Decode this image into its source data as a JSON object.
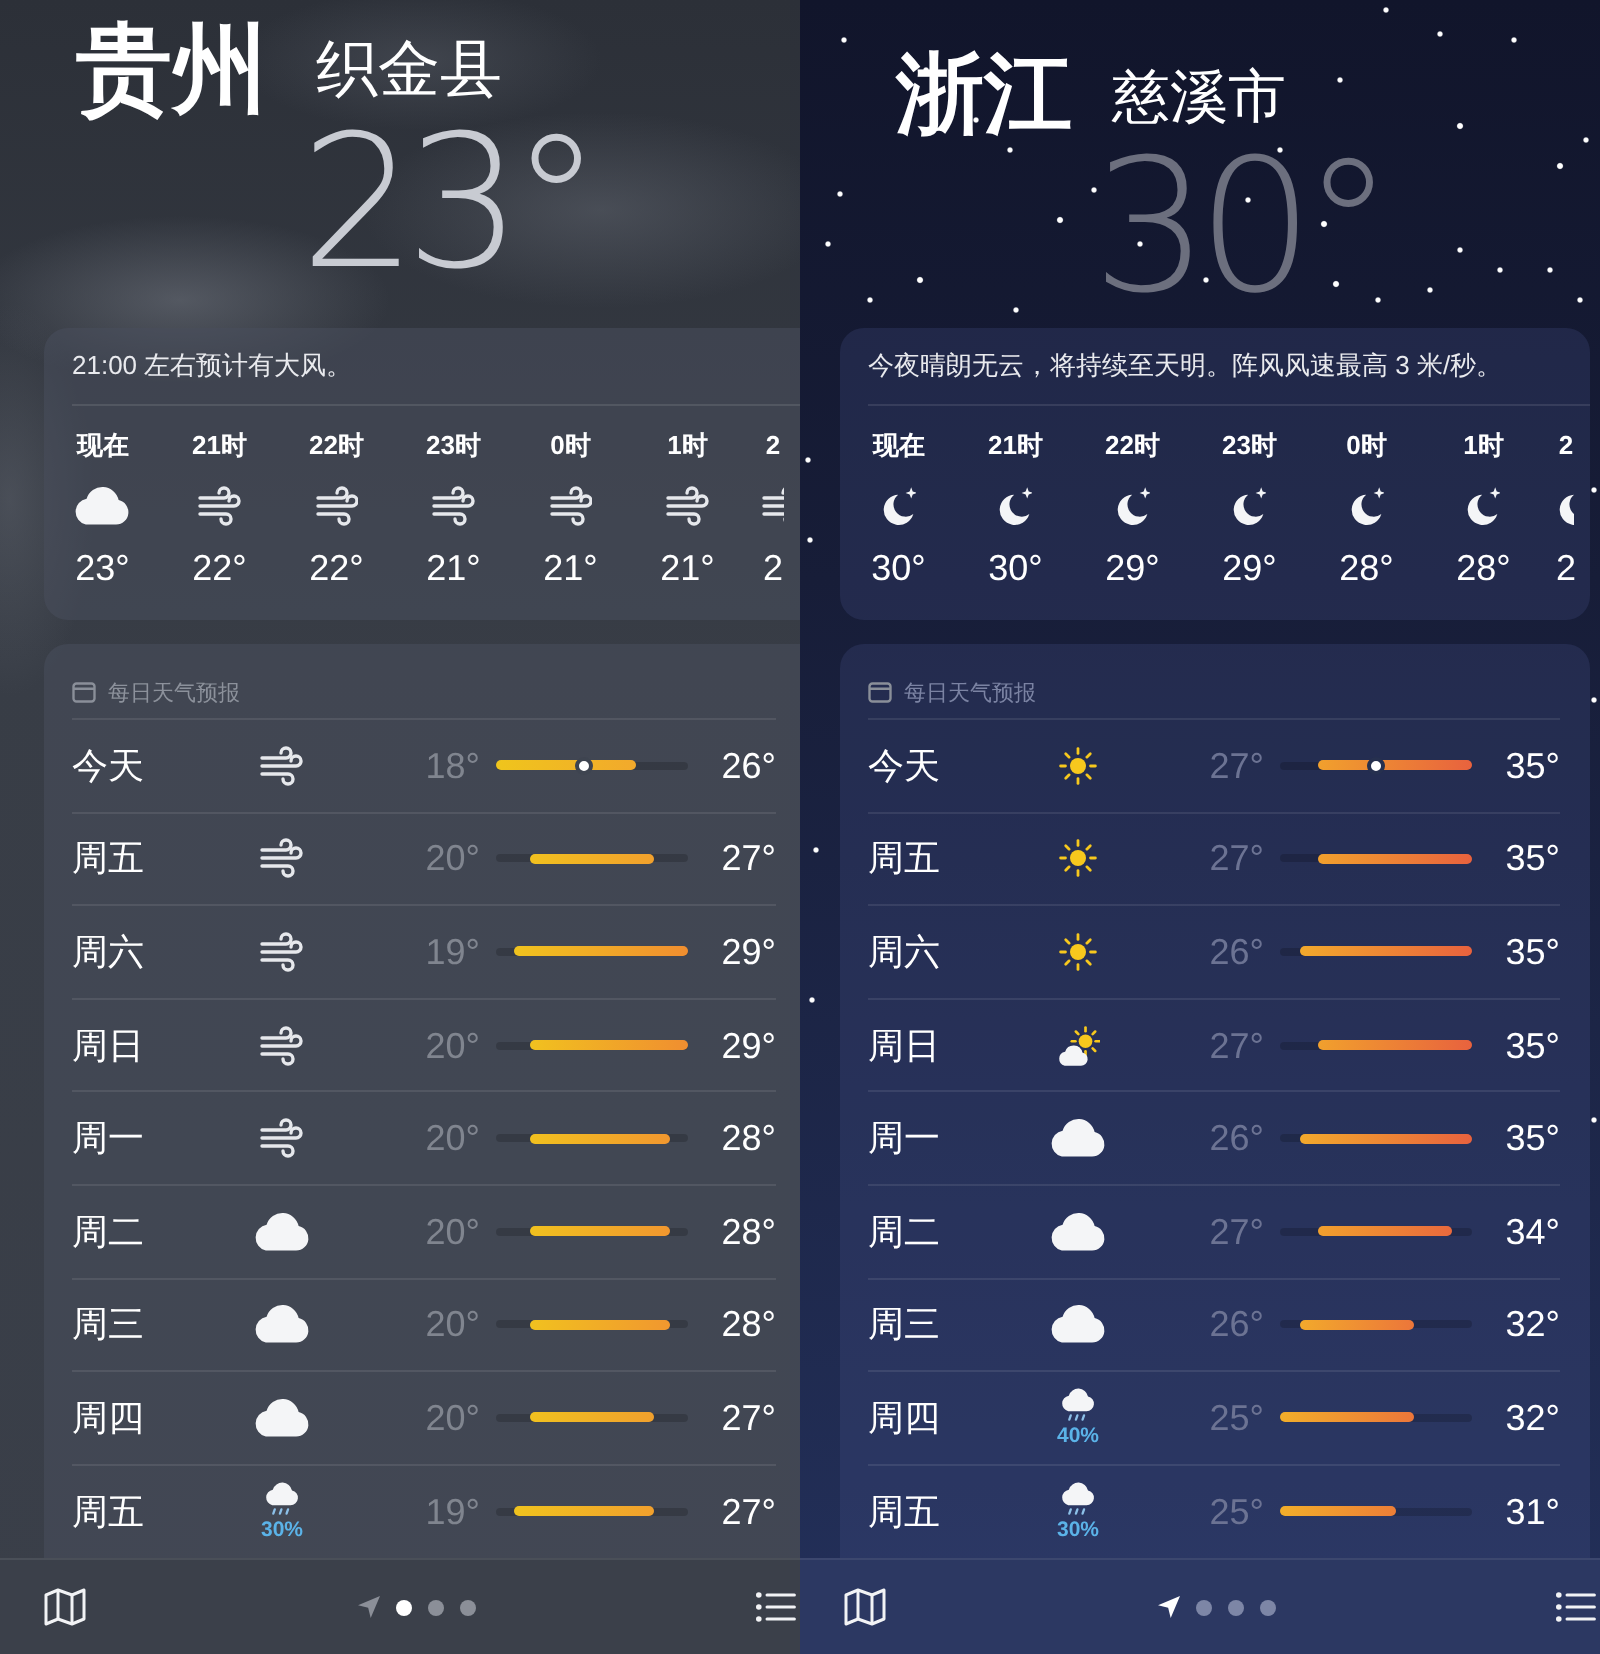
{
  "panels": [
    {
      "kind": "cloudy",
      "province": "贵州",
      "city": "织金县",
      "temperature": "23°",
      "summary": "21:00 左右预计有大风。",
      "hourly": [
        {
          "time": "现在",
          "kind": "cloud",
          "temp": "23°"
        },
        {
          "time": "21时",
          "kind": "wind",
          "temp": "22°"
        },
        {
          "time": "22时",
          "kind": "wind",
          "temp": "22°"
        },
        {
          "time": "23时",
          "kind": "wind",
          "temp": "21°"
        },
        {
          "time": "0时",
          "kind": "wind",
          "temp": "21°"
        },
        {
          "time": "1时",
          "kind": "wind",
          "temp": "21°"
        },
        {
          "time": "2",
          "kind": "wind",
          "temp": "2"
        }
      ],
      "daily_title": "每日天气预报",
      "daily": [
        {
          "day": "今天",
          "kind": "wind",
          "low": "18°",
          "high": "26°",
          "current": true
        },
        {
          "day": "周五",
          "kind": "wind",
          "low": "20°",
          "high": "27°",
          "current": false
        },
        {
          "day": "周六",
          "kind": "wind",
          "low": "19°",
          "high": "29°",
          "current": false
        },
        {
          "day": "周日",
          "kind": "wind",
          "low": "20°",
          "high": "29°",
          "current": false
        },
        {
          "day": "周一",
          "kind": "wind",
          "low": "20°",
          "high": "28°",
          "current": false
        },
        {
          "day": "周二",
          "kind": "cloud",
          "low": "20°",
          "high": "28°",
          "current": false
        },
        {
          "day": "周三",
          "kind": "cloud",
          "low": "20°",
          "high": "28°",
          "current": false
        },
        {
          "day": "周四",
          "kind": "cloud",
          "low": "20°",
          "high": "27°",
          "current": false
        },
        {
          "day": "周五",
          "kind": "rain",
          "precip": "30%",
          "low": "19°",
          "high": "27°",
          "current": false
        }
      ],
      "bottom_bar": {
        "pages": [
          {
            "kind": "location",
            "selected": false
          },
          {
            "kind": "dot",
            "selected": true
          },
          {
            "kind": "dot",
            "selected": false
          },
          {
            "kind": "dot",
            "selected": false
          }
        ]
      }
    },
    {
      "kind": "night",
      "province": "浙江",
      "city": "慈溪市",
      "temperature": "30°",
      "summary": "今夜晴朗无云，将持续至天明。阵风风速最高 3 米/秒。",
      "hourly": [
        {
          "time": "现在",
          "kind": "moon",
          "temp": "30°"
        },
        {
          "time": "21时",
          "kind": "moon",
          "temp": "30°"
        },
        {
          "time": "22时",
          "kind": "moon",
          "temp": "29°"
        },
        {
          "time": "23时",
          "kind": "moon",
          "temp": "29°"
        },
        {
          "time": "0时",
          "kind": "moon",
          "temp": "28°"
        },
        {
          "time": "1时",
          "kind": "moon",
          "temp": "28°"
        },
        {
          "time": "2",
          "kind": "moon",
          "temp": "2"
        }
      ],
      "daily_title": "每日天气预报",
      "daily": [
        {
          "day": "今天",
          "kind": "sun",
          "low": "27°",
          "high": "35°",
          "current": true
        },
        {
          "day": "周五",
          "kind": "sun",
          "low": "27°",
          "high": "35°",
          "current": false
        },
        {
          "day": "周六",
          "kind": "sun",
          "low": "26°",
          "high": "35°",
          "current": false
        },
        {
          "day": "周日",
          "kind": "partly-cloudy",
          "low": "27°",
          "high": "35°",
          "current": false
        },
        {
          "day": "周一",
          "kind": "cloud",
          "low": "26°",
          "high": "35°",
          "current": false
        },
        {
          "day": "周二",
          "kind": "cloud",
          "low": "27°",
          "high": "34°",
          "current": false
        },
        {
          "day": "周三",
          "kind": "cloud",
          "low": "26°",
          "high": "32°",
          "current": false
        },
        {
          "day": "周四",
          "kind": "rain",
          "precip": "40%",
          "low": "25°",
          "high": "32°",
          "current": false
        },
        {
          "day": "周五",
          "kind": "rain",
          "precip": "30%",
          "low": "25°",
          "high": "31°",
          "current": false
        }
      ],
      "bottom_bar": {
        "pages": [
          {
            "kind": "location",
            "selected": true
          },
          {
            "kind": "dot",
            "selected": false
          },
          {
            "kind": "dot",
            "selected": false
          },
          {
            "kind": "dot",
            "selected": false
          }
        ]
      }
    }
  ]
}
